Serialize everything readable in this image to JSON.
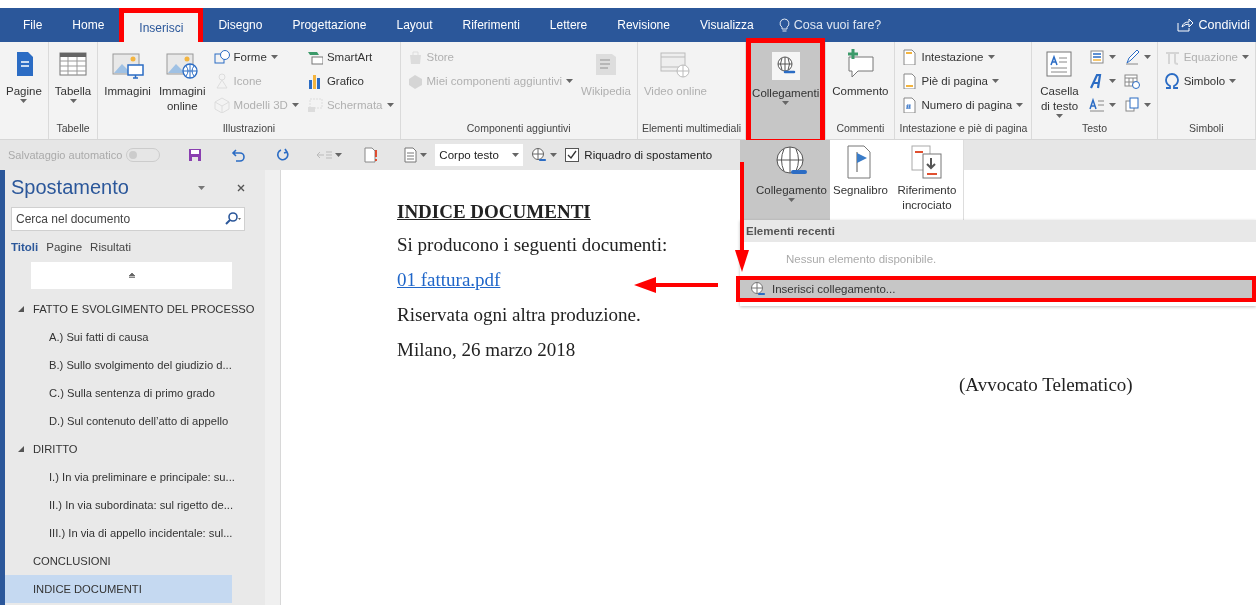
{
  "tabs": [
    {
      "label": "File",
      "selected": false,
      "annotated": false
    },
    {
      "label": "Home",
      "selected": false,
      "annotated": false
    },
    {
      "label": "Inserisci",
      "selected": true,
      "annotated": true
    },
    {
      "label": "Disegno",
      "selected": false,
      "annotated": false
    },
    {
      "label": "Progettazione",
      "selected": false,
      "annotated": false
    },
    {
      "label": "Layout",
      "selected": false,
      "annotated": false
    },
    {
      "label": "Riferimenti",
      "selected": false,
      "annotated": false
    },
    {
      "label": "Lettere",
      "selected": false,
      "annotated": false
    },
    {
      "label": "Revisione",
      "selected": false,
      "annotated": false
    },
    {
      "label": "Visualizza",
      "selected": false,
      "annotated": false
    }
  ],
  "tell_me": "Cosa vuoi fare?",
  "share": "Condividi",
  "ribbon": [
    {
      "items": [
        {
          "kind": "large",
          "label": "Pagine",
          "dropdown": true,
          "disabled": false,
          "pressed": false,
          "annotated": false
        }
      ]
    },
    {
      "label": "Tabelle",
      "items": [
        {
          "kind": "large",
          "label": "Tabella",
          "dropdown": true,
          "disabled": false,
          "pressed": false,
          "annotated": false
        }
      ]
    },
    {
      "label": "Illustrazioni",
      "items": [
        {
          "kind": "large",
          "label": "Immagini",
          "dropdown": false,
          "disabled": false,
          "pressed": false,
          "annotated": false
        },
        {
          "kind": "large",
          "label": "Immagini online",
          "dropdown": false,
          "disabled": false,
          "pressed": false,
          "annotated": false
        },
        {
          "kind": "stack",
          "items": [
            {
              "label": "Forme",
              "dropdown": true,
              "disabled": false
            },
            {
              "label": "Icone",
              "dropdown": false,
              "disabled": true
            },
            {
              "label": "Modelli 3D",
              "dropdown": true,
              "disabled": true
            }
          ]
        },
        {
          "kind": "stack",
          "items": [
            {
              "label": "SmartArt",
              "dropdown": false,
              "disabled": false
            },
            {
              "label": "Grafico",
              "dropdown": false,
              "disabled": false
            },
            {
              "label": "Schermata",
              "dropdown": true,
              "disabled": true
            }
          ]
        }
      ]
    },
    {
      "label": "Componenti aggiuntivi",
      "items": [
        {
          "kind": "stack",
          "items": [
            {
              "label": "Store",
              "dropdown": false,
              "disabled": true
            },
            {
              "label": "Miei componenti aggiuntivi",
              "dropdown": true,
              "disabled": true
            }
          ]
        },
        {
          "kind": "large",
          "label": "Wikipedia",
          "dropdown": false,
          "disabled": true,
          "pressed": false,
          "annotated": false
        }
      ]
    },
    {
      "label": "Elementi multimediali",
      "items": [
        {
          "kind": "large",
          "label": "Video online",
          "dropdown": false,
          "disabled": true,
          "pressed": false,
          "annotated": false
        }
      ]
    },
    {
      "items": [
        {
          "kind": "large",
          "label": "Collegamenti",
          "dropdown": true,
          "disabled": false,
          "pressed": true,
          "annotated": true
        }
      ]
    },
    {
      "label": "Commenti",
      "items": [
        {
          "kind": "large",
          "label": "Commento",
          "dropdown": false,
          "disabled": false,
          "pressed": false,
          "annotated": false
        }
      ]
    },
    {
      "label": "Intestazione e piè di pagina",
      "items": [
        {
          "kind": "stack",
          "items": [
            {
              "label": "Intestazione",
              "dropdown": true,
              "disabled": false
            },
            {
              "label": "Piè di pagina",
              "dropdown": true,
              "disabled": false
            },
            {
              "label": "Numero di pagina",
              "dropdown": true,
              "disabled": false
            }
          ]
        }
      ]
    },
    {
      "label": "Testo",
      "items": [
        {
          "kind": "large",
          "label": "Casella di testo",
          "dropdown": true,
          "disabled": false,
          "pressed": false,
          "annotated": false
        },
        {
          "kind": "icons",
          "items": [
            {
              "dropdown": true,
              "disabled": false
            },
            {
              "dropdown": true,
              "disabled": false
            },
            {
              "dropdown": true,
              "disabled": false
            }
          ]
        },
        {
          "kind": "icons",
          "items": [
            {
              "dropdown": true,
              "disabled": false
            },
            {
              "dropdown": false,
              "disabled": false
            },
            {
              "dropdown": true,
              "disabled": false
            }
          ]
        }
      ]
    },
    {
      "label": "Simboli",
      "items": [
        {
          "kind": "stack",
          "items": [
            {
              "label": "Equazione",
              "dropdown": true,
              "disabled": true
            },
            {
              "label": "Simbolo",
              "dropdown": true,
              "disabled": false
            }
          ]
        }
      ]
    }
  ],
  "quick_access": {
    "autosave": {
      "label": "Salvataggio automatico",
      "on": false
    },
    "style": "Corpo testo",
    "nav_pane": {
      "label": "Riquadro di spostamento",
      "checked": true
    }
  },
  "nav_pane": {
    "title": "Spostamento",
    "search": {
      "placeholder": "Cerca nel documento"
    },
    "tabs": [
      {
        "label": "Titoli",
        "selected": true
      },
      {
        "label": "Pagine",
        "selected": false
      },
      {
        "label": "Risultati",
        "selected": false
      }
    ],
    "headings": [
      {
        "label": "FATTO E SVOLGIMENTO DEL PROCESSO",
        "expanded": true,
        "selected": false,
        "children": [
          {
            "label": "A.) Sui fatti di causa",
            "selected": false
          },
          {
            "label": "B.) Sullo svolgimento del giudizio d...",
            "selected": false
          },
          {
            "label": "C.) Sulla sentenza di primo grado",
            "selected": false
          },
          {
            "label": "D.) Sul contenuto dell’atto di appello",
            "selected": false
          }
        ]
      },
      {
        "label": "DIRITTO",
        "expanded": true,
        "selected": false,
        "children": [
          {
            "label": "I.) In via preliminare e principale: su...",
            "selected": false
          },
          {
            "label": "II.) In via subordinata: sul rigetto de...",
            "selected": false
          },
          {
            "label": "III.) In via di appello incidentale: sul...",
            "selected": false
          }
        ]
      },
      {
        "label": "CONCLUSIONI",
        "selected": false
      },
      {
        "label": "INDICE DOCUMENTI",
        "selected": true
      }
    ]
  },
  "document": {
    "paragraphs": [
      {
        "kind": "heading",
        "text": "INDICE DOCUMENTI"
      },
      {
        "kind": "text",
        "text": "Si producono i seguenti documenti:"
      },
      {
        "kind": "link",
        "text": "01 fattura.pdf"
      },
      {
        "kind": "text",
        "text": "Riservata ogni altra produzione."
      },
      {
        "kind": "text",
        "text": "Milano, 26 marzo 2018"
      },
      {
        "kind": "signature",
        "text": "(Avvocato Telematico)"
      }
    ]
  },
  "links_menu": {
    "buttons": [
      {
        "label": "Collegamento",
        "selected": true,
        "dropdown": true
      },
      {
        "label": "Segnalibro",
        "selected": false,
        "dropdown": false
      },
      {
        "label": "Riferimento incrociato",
        "selected": false,
        "dropdown": false
      }
    ],
    "section": "Elementi recenti",
    "empty": "Nessun elemento disponibile.",
    "command": {
      "label": "Inserisci collegamento...",
      "highlighted": true,
      "annotated": true
    }
  },
  "annotations": [
    {
      "kind": "arrow-down"
    },
    {
      "kind": "arrow-left"
    }
  ]
}
